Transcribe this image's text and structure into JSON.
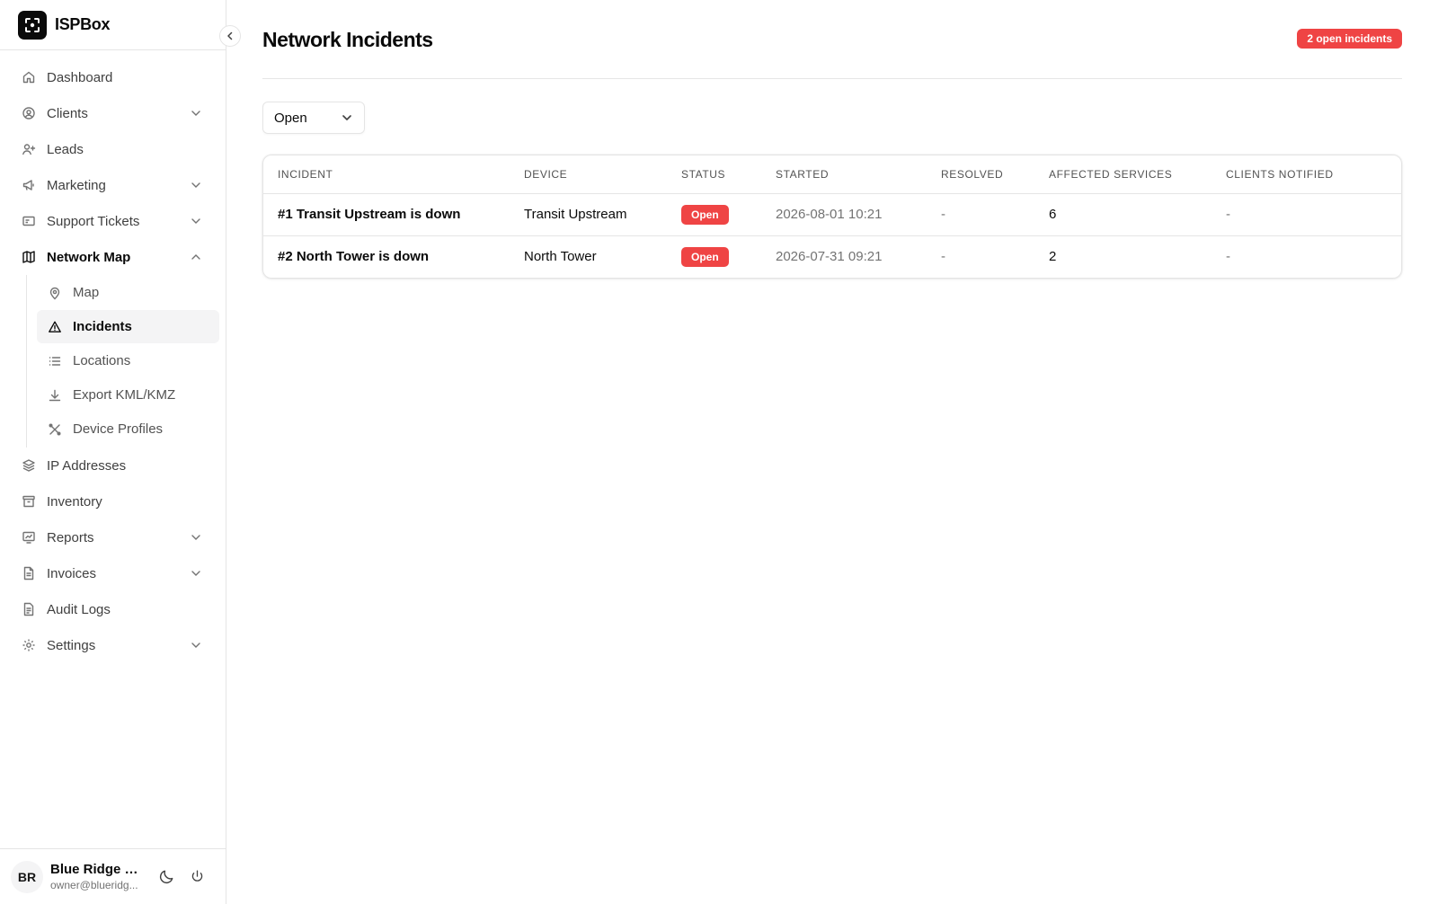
{
  "brand": {
    "name": "ISPBox"
  },
  "sidebar": {
    "items": [
      {
        "label": "Dashboard",
        "icon": "home-icon",
        "has_chevron": false
      },
      {
        "label": "Clients",
        "icon": "user-circle-icon",
        "has_chevron": true
      },
      {
        "label": "Leads",
        "icon": "user-plus-icon",
        "has_chevron": false
      },
      {
        "label": "Marketing",
        "icon": "megaphone-icon",
        "has_chevron": true
      },
      {
        "label": "Support Tickets",
        "icon": "ticket-icon",
        "has_chevron": true
      },
      {
        "label": "Network Map",
        "icon": "map-icon",
        "has_chevron": true,
        "expanded": true
      },
      {
        "label": "IP Addresses",
        "icon": "layers-icon",
        "has_chevron": false
      },
      {
        "label": "Inventory",
        "icon": "archive-icon",
        "has_chevron": false
      },
      {
        "label": "Reports",
        "icon": "chart-icon",
        "has_chevron": true
      },
      {
        "label": "Invoices",
        "icon": "file-icon",
        "has_chevron": true
      },
      {
        "label": "Audit Logs",
        "icon": "file-text-icon",
        "has_chevron": false
      },
      {
        "label": "Settings",
        "icon": "gear-icon",
        "has_chevron": true
      }
    ],
    "network_sub": [
      {
        "label": "Map",
        "icon": "map-pin-icon"
      },
      {
        "label": "Incidents",
        "icon": "alert-triangle-icon",
        "active": true
      },
      {
        "label": "Locations",
        "icon": "list-icon"
      },
      {
        "label": "Export KML/KMZ",
        "icon": "download-icon"
      },
      {
        "label": "Device Profiles",
        "icon": "tools-icon"
      }
    ]
  },
  "user": {
    "initials": "BR",
    "name": "Blue Ridge O...",
    "email": "owner@blueridg..."
  },
  "page": {
    "title": "Network Incidents",
    "badge": "2 open incidents"
  },
  "filter": {
    "status_value": "Open"
  },
  "table": {
    "columns": [
      "INCIDENT",
      "DEVICE",
      "STATUS",
      "STARTED",
      "RESOLVED",
      "AFFECTED SERVICES",
      "CLIENTS NOTIFIED"
    ],
    "rows": [
      {
        "incident": "#1 Transit Upstream is down",
        "device": "Transit Upstream",
        "status": "Open",
        "started": "2026-08-01 10:21",
        "resolved": "-",
        "affected": "6",
        "notified": "-"
      },
      {
        "incident": "#2 North Tower is down",
        "device": "North Tower",
        "status": "Open",
        "started": "2026-07-31 09:21",
        "resolved": "-",
        "affected": "2",
        "notified": "-"
      }
    ]
  },
  "colors": {
    "accent_red": "#ef4444",
    "border": "#e5e5e5",
    "active_bg": "#f4f4f5"
  }
}
